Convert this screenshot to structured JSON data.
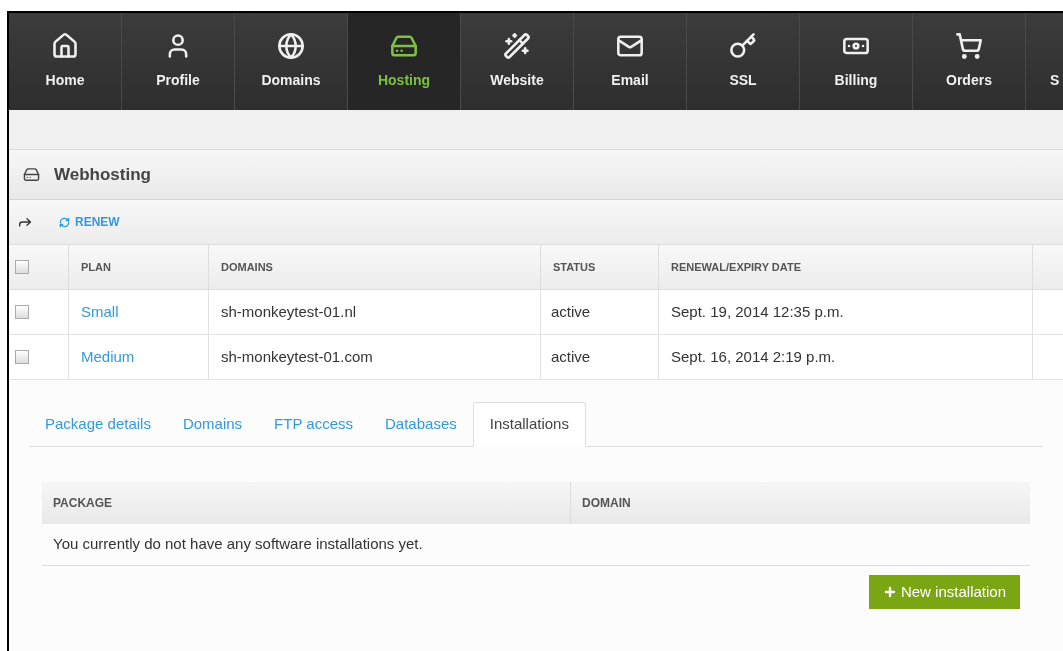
{
  "nav": [
    {
      "label": "Home",
      "selected": false
    },
    {
      "label": "Profile",
      "selected": false
    },
    {
      "label": "Domains",
      "selected": false
    },
    {
      "label": "Hosting",
      "selected": true
    },
    {
      "label": "Website",
      "selected": false
    },
    {
      "label": "Email",
      "selected": false
    },
    {
      "label": "SSL",
      "selected": false
    },
    {
      "label": "Billing",
      "selected": false
    },
    {
      "label": "Orders",
      "selected": false
    },
    {
      "label": "S",
      "selected": false
    }
  ],
  "panel": {
    "title": "Webhosting",
    "renew": "RENEW"
  },
  "table": {
    "select_all": {
      "checked": false
    },
    "columns": [
      "PLAN",
      "DOMAINS",
      "STATUS",
      "RENEWAL/EXPIRY DATE"
    ],
    "rows": [
      {
        "checked": false,
        "plan": "Small",
        "domain": "sh-monkeytest-01.nl",
        "status": "active",
        "date": "Sept. 19, 2014 12:35 p.m."
      },
      {
        "checked": false,
        "plan": "Medium",
        "domain": "sh-monkeytest-01.com",
        "status": "active",
        "date": "Sept. 16, 2014 2:19 p.m."
      }
    ]
  },
  "tabs": [
    {
      "label": "Package details",
      "selected": false
    },
    {
      "label": "Domains",
      "selected": false
    },
    {
      "label": "FTP access",
      "selected": false
    },
    {
      "label": "Databases",
      "selected": false
    },
    {
      "label": "Installations",
      "selected": true
    }
  ],
  "installations": {
    "columns": [
      "PACKAGE",
      "DOMAIN"
    ],
    "empty": "You currently do not have any software installations yet.",
    "button": "New installation"
  }
}
